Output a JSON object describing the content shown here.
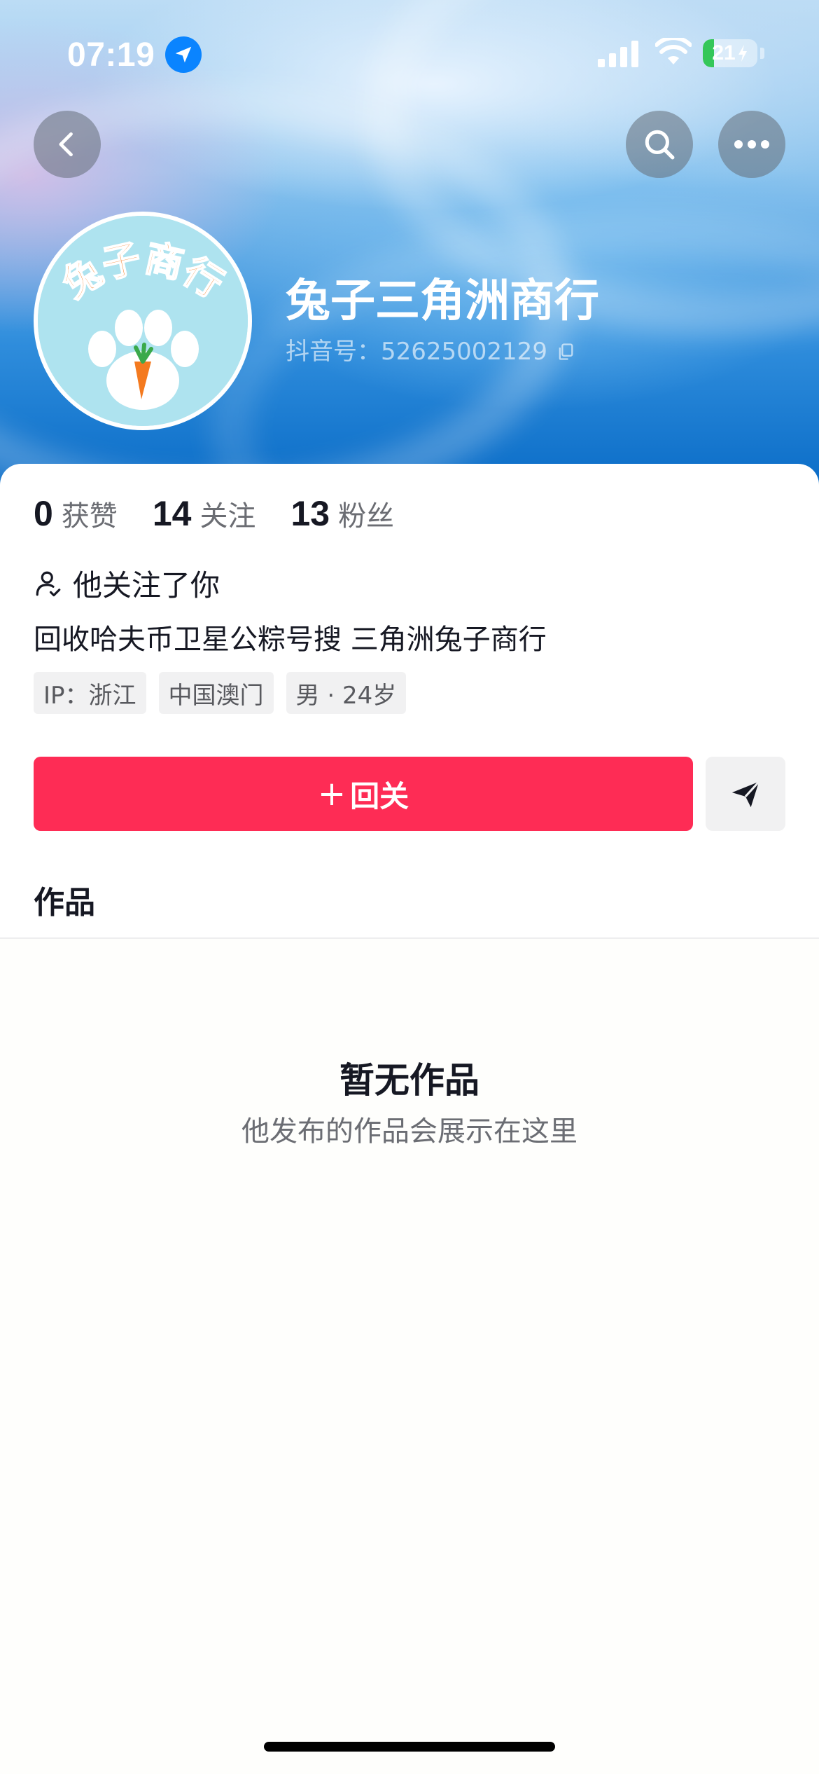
{
  "status_bar": {
    "time": "07:19",
    "battery": "21",
    "battery_level": 0.21
  },
  "nav": {
    "back_icon": "chevron-left-icon",
    "search_icon": "search-icon",
    "more_icon": "more-horizontal-icon"
  },
  "profile": {
    "avatar_text": "兔子商行",
    "name": "兔子三角洲商行",
    "douyin_id": "抖音号：52625002129"
  },
  "stats": [
    {
      "value": "0",
      "label": "获赞"
    },
    {
      "value": "14",
      "label": "关注"
    },
    {
      "value": "13",
      "label": "粉丝"
    }
  ],
  "follow_note": "他关注了你",
  "bio": "回收哈夫币卫星公粽号搜 三角洲兔子商行",
  "tags": [
    "IP：浙江",
    "中国澳门",
    "男 · 24岁"
  ],
  "actions": {
    "follow_plus": "+",
    "follow_label": "回关",
    "send_icon": "send-message-icon"
  },
  "works": {
    "tab_label": "作品",
    "empty_title": "暂无作品",
    "empty_subtitle": "他发布的作品会展示在这里"
  },
  "colors": {
    "primary": "#fe2c55",
    "text": "#161823",
    "secondary_text": "#6b6d73"
  }
}
